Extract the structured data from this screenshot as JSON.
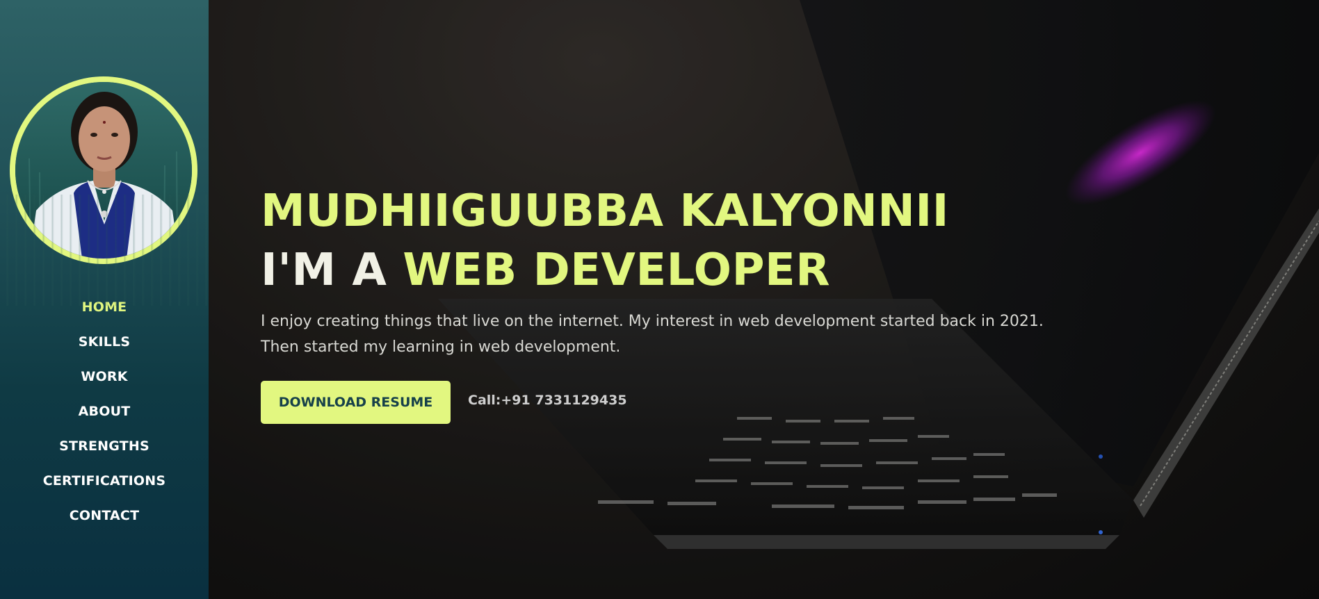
{
  "profile": {
    "photo_alt": "profile photo"
  },
  "nav": {
    "items": [
      {
        "label": "HOME",
        "active": true
      },
      {
        "label": "SKILLS",
        "active": false
      },
      {
        "label": "WORK",
        "active": false
      },
      {
        "label": "ABOUT",
        "active": false
      },
      {
        "label": "STRENGTHS",
        "active": false
      },
      {
        "label": "CERTIFICATIONS",
        "active": false
      },
      {
        "label": "CONTACT",
        "active": false
      }
    ]
  },
  "hero": {
    "name": "MUDHIIGUUBBA KALYONNII",
    "role_prefix": "I'M A ",
    "role_accent": "WEB DEVELOPER",
    "intro_line1": "I enjoy creating things that live on the internet. My interest in web development started back in 2021.",
    "intro_line2": "Then started my learning in web development.",
    "resume_button": "DOWNLOAD RESUME",
    "call_text": "Call:+91 7331129435"
  },
  "colors": {
    "accent": "#e2f780",
    "sidebar_top": "#2e6266",
    "sidebar_bottom": "#0a3040",
    "button_text": "#17414a"
  }
}
